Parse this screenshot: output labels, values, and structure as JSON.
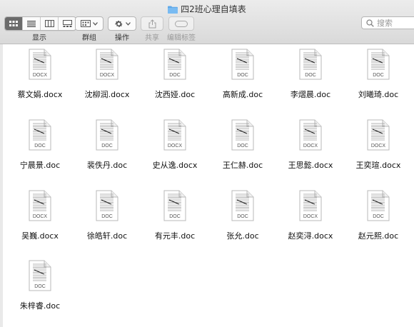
{
  "window": {
    "title": "四2班心理自填表"
  },
  "toolbar": {
    "view_label": "显示",
    "group_label": "群组",
    "action_label": "操作",
    "share_label": "共享",
    "tags_label": "编辑标签",
    "search_placeholder": "搜索"
  },
  "files": [
    {
      "name": "蔡文娟.docx",
      "type": "DOCX"
    },
    {
      "name": "沈柳润.docx",
      "type": "DOCX"
    },
    {
      "name": "沈西娅.doc",
      "type": "DOC"
    },
    {
      "name": "高新成.doc",
      "type": "DOC"
    },
    {
      "name": "李熠晨.doc",
      "type": "DOC"
    },
    {
      "name": "刘曦琦.doc",
      "type": "DOC"
    },
    {
      "name": "宁晨景.doc",
      "type": "DOC"
    },
    {
      "name": "裴佚丹.doc",
      "type": "DOC"
    },
    {
      "name": "史从逸.docx",
      "type": "DOCX"
    },
    {
      "name": "王仁赫.doc",
      "type": "DOC"
    },
    {
      "name": "王思懿.docx",
      "type": "DOCX"
    },
    {
      "name": "王奕瑄.docx",
      "type": "DOCX"
    },
    {
      "name": "吴巍.docx",
      "type": "DOCX"
    },
    {
      "name": "徐皓轩.doc",
      "type": "DOC"
    },
    {
      "name": "有元丰.doc",
      "type": "DOC"
    },
    {
      "name": "张允.doc",
      "type": "DOC"
    },
    {
      "name": "赵奕浔.docx",
      "type": "DOCX"
    },
    {
      "name": "赵元熙.doc",
      "type": "DOC"
    },
    {
      "name": "朱梓睿.doc",
      "type": "DOC"
    }
  ]
}
